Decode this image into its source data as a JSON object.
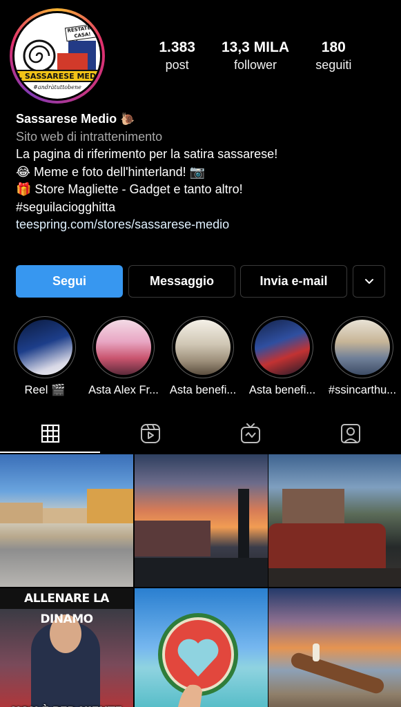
{
  "avatar": {
    "sign_text": "RESTATE A CASA!",
    "band_text": "IL SASSARESE MEDIO",
    "tagline": "#andràtuttobene"
  },
  "stats": [
    {
      "value": "1.383",
      "label": "post"
    },
    {
      "value": "13,3 MILA",
      "label": "follower"
    },
    {
      "value": "180",
      "label": "seguiti"
    }
  ],
  "bio": {
    "name": "Sassarese Medio",
    "name_icon": "snail-icon",
    "category": "Sito web di intrattenimento",
    "lines": [
      "La pagina di riferimento per la satira sassarese!",
      "😂  Meme e foto dell'hinterland!  📷",
      "🎁 Store Magliette - Gadget e tanto altro!",
      "#seguilaciogghitta"
    ],
    "link": "teespring.com/stores/sassarese-medio"
  },
  "buttons": {
    "follow": "Segui",
    "message": "Messaggio",
    "email": "Invia e-mail",
    "more_icon": "chevron-down-icon"
  },
  "highlights": [
    {
      "label": "Reel 🎬"
    },
    {
      "label": "Asta Alex Fr..."
    },
    {
      "label": "Asta benefi..."
    },
    {
      "label": "Asta benefi..."
    },
    {
      "label": "#ssincarthu..."
    }
  ],
  "tabs": [
    {
      "icon": "grid-icon",
      "active": true
    },
    {
      "icon": "reels-icon",
      "active": false
    },
    {
      "icon": "igtv-icon",
      "active": false
    },
    {
      "icon": "tagged-icon",
      "active": false
    }
  ],
  "posts": [
    {
      "kind": "photo"
    },
    {
      "kind": "photo"
    },
    {
      "kind": "photo"
    },
    {
      "kind": "meme",
      "top_text": "ALLENARE LA DINAMO",
      "bottom_text": "NON È PER NIENTE"
    },
    {
      "kind": "photo"
    },
    {
      "kind": "photo"
    }
  ],
  "colors": {
    "background": "#000000",
    "follow_button": "#3797f0",
    "category_text": "#a8a8a8",
    "link_text": "#e0f1ff"
  }
}
